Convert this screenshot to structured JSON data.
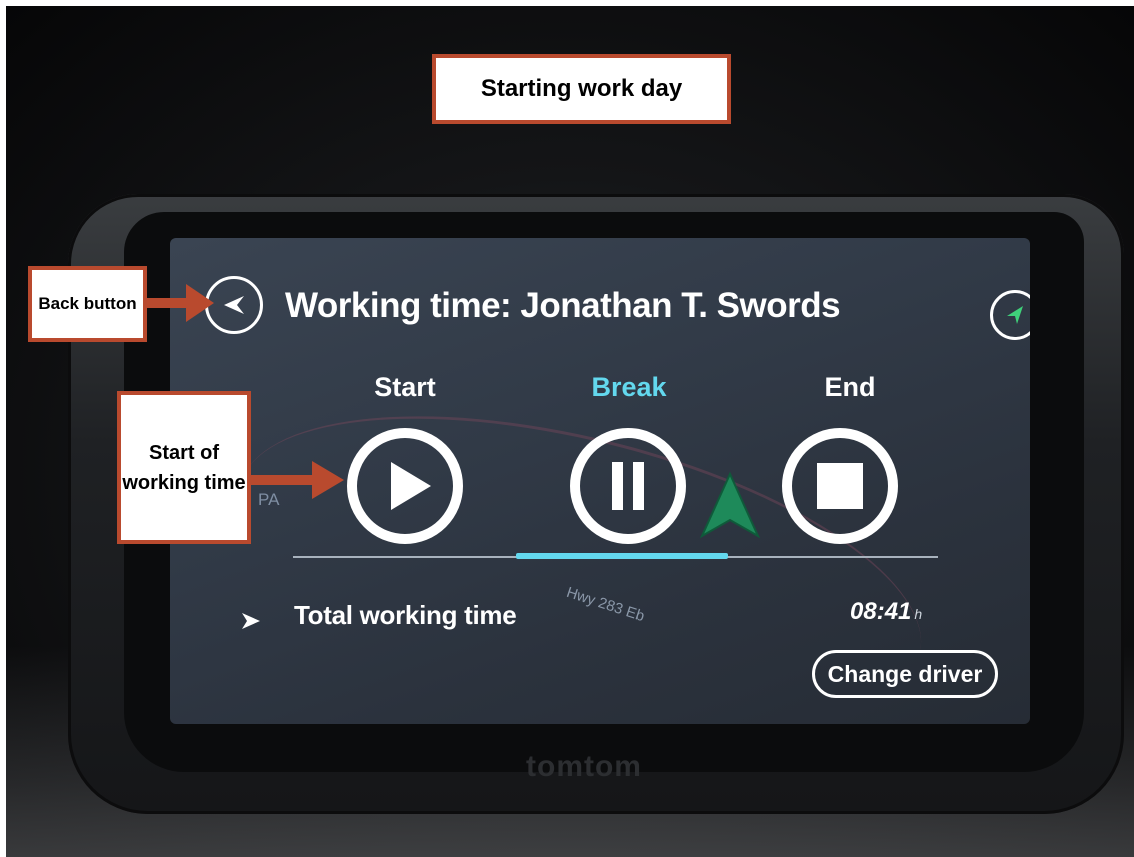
{
  "annotations": {
    "title": "Starting work day",
    "back_button": "Back button",
    "start_of_working_time": "Start of working time",
    "accent_color": "#b94a2e"
  },
  "screen": {
    "title": "Working time: Jonathan T. Swords",
    "back_icon": "back-arrow-icon",
    "nav_icon": "navigation-arrow-icon",
    "controls": [
      {
        "label": "Start",
        "icon": "play-icon",
        "active": false
      },
      {
        "label": "Break",
        "icon": "pause-icon",
        "active": true
      },
      {
        "label": "End",
        "icon": "stop-icon",
        "active": false
      }
    ],
    "active_color": "#63d8ee",
    "map_labels": {
      "state": "PA",
      "road": "Hwy 283 Eb"
    },
    "total_working_time": {
      "label": "Total working time",
      "value": "08:41",
      "unit": "h"
    },
    "change_driver_label": "Change driver"
  },
  "device": {
    "brand": "tomtom"
  }
}
